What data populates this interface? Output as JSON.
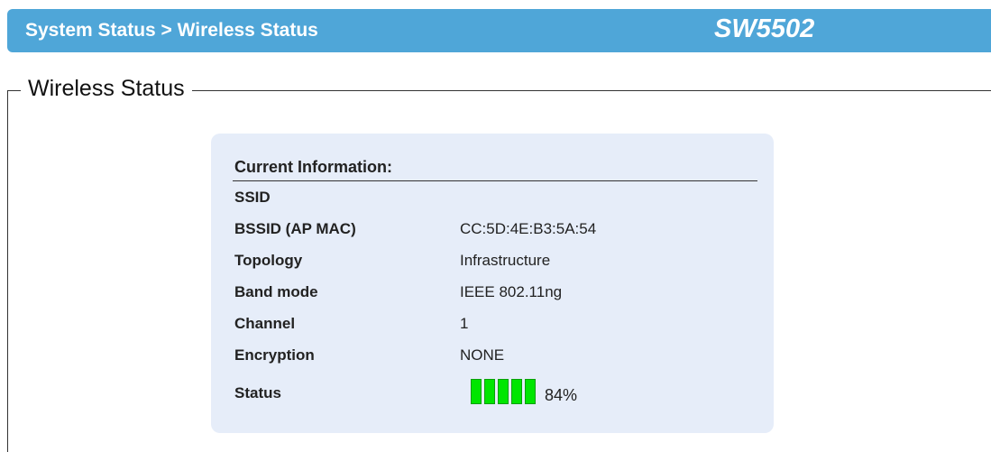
{
  "header": {
    "breadcrumb": "System Status > Wireless Status",
    "model": "SW5502"
  },
  "section": {
    "legend": "Wireless Status"
  },
  "info": {
    "title": "Current Information:",
    "rows": [
      {
        "label": "SSID",
        "value": ""
      },
      {
        "label": "BSSID (AP MAC)",
        "value": "CC:5D:4E:B3:5A:54"
      },
      {
        "label": "Topology",
        "value": "Infrastructure"
      },
      {
        "label": "Band mode",
        "value": "IEEE 802.11ng"
      },
      {
        "label": "Channel",
        "value": "1"
      },
      {
        "label": "Encryption",
        "value": "NONE"
      }
    ],
    "status": {
      "label": "Status",
      "signal_percent_text": "84%",
      "signal_bars": 5,
      "bar_color": "#00e600"
    }
  }
}
